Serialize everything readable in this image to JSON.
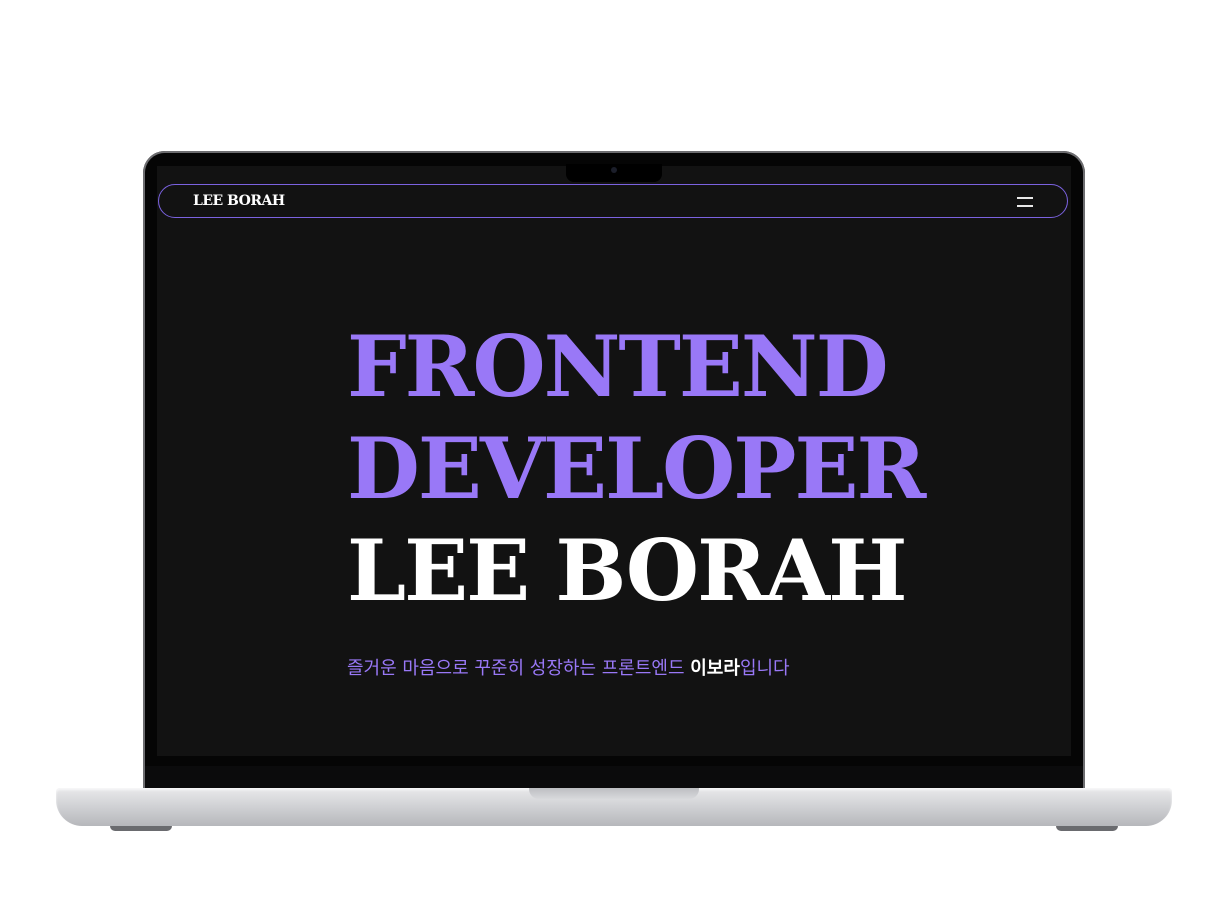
{
  "site": {
    "logo": "LEE BORAH",
    "menu_icon": "hamburger-menu-icon"
  },
  "hero": {
    "line1": "FRONTEND",
    "line2": "DEVELOPER",
    "line3": "LEE BORAH"
  },
  "tagline": {
    "prefix": "즐거운 마음으로 꾸준히 성장하는 프론트엔드 ",
    "name": "이보라",
    "suffix": "입니다"
  },
  "colors": {
    "accent": "#9978f7",
    "background": "#121212",
    "text": "#ffffff",
    "nav_border": "#7b62e0"
  }
}
